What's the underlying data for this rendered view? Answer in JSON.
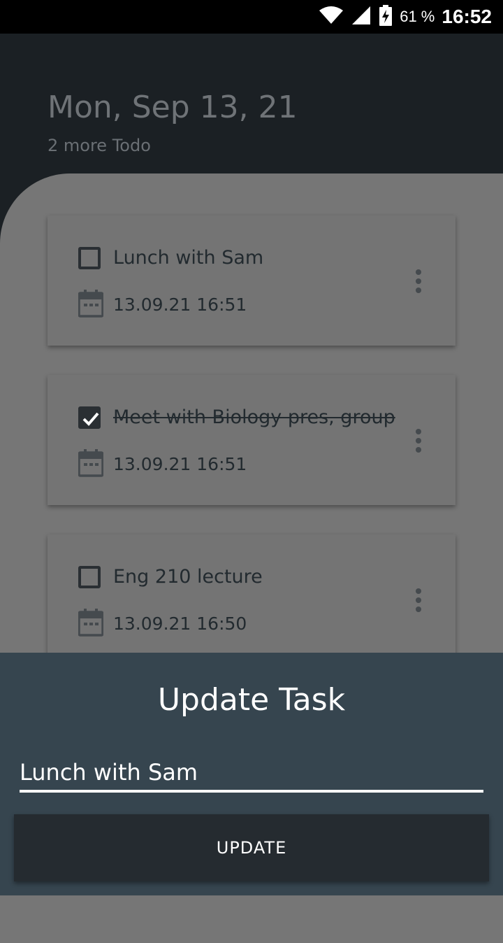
{
  "status_bar": {
    "battery_percent": "61 %",
    "time": "16:52",
    "icons": [
      "wifi-icon",
      "signal-icon",
      "battery-charging-icon"
    ]
  },
  "header": {
    "date": "Mon, Sep 13, 21",
    "subtitle": "2 more Todo"
  },
  "tasks": [
    {
      "title": "Lunch with Sam",
      "datetime": "13.09.21 16:51",
      "done": false
    },
    {
      "title": "Meet with Biology pres, group",
      "datetime": "13.09.21 16:51",
      "done": true
    },
    {
      "title": "Eng 210 lecture",
      "datetime": "13.09.21 16:50",
      "done": false
    }
  ],
  "dialog": {
    "title": "Update Task",
    "input_value": "Lunch with Sam",
    "button_label": "UPDATE"
  },
  "colors": {
    "header_bg": "#1b2024",
    "sheet_bg": "#767676",
    "dialog_bg": "#36454f",
    "button_bg": "#252b30"
  }
}
